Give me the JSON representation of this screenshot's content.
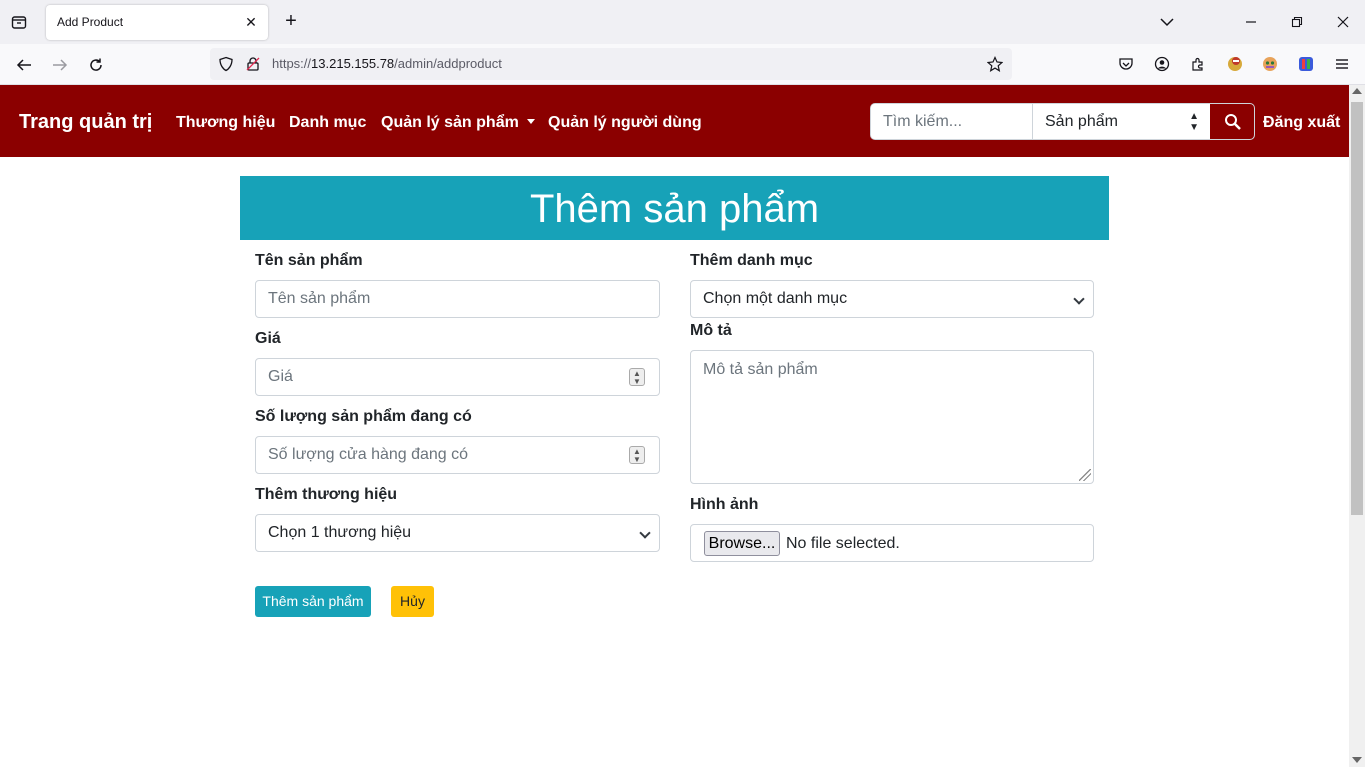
{
  "browser": {
    "tab_title": "Add Product",
    "url_prefix": "https://",
    "url_host": "13.215.155.78",
    "url_path": "/admin/addproduct"
  },
  "nav": {
    "brand": "Trang quản trị",
    "links": [
      "Thương hiệu",
      "Danh mục",
      "Quản lý sản phẩm",
      "Quản lý người dùng"
    ],
    "search_placeholder": "Tìm kiếm...",
    "search_category": "Sản phẩm",
    "logout": "Đăng xuất"
  },
  "form": {
    "heading": "Thêm sản phẩm",
    "name_label": "Tên sản phẩm",
    "name_placeholder": "Tên sản phẩm",
    "price_label": "Giá",
    "price_placeholder": "Giá",
    "stock_label": "Số lượng sản phẩm đang có",
    "stock_placeholder": "Số lượng cửa hàng đang có",
    "brand_label": "Thêm thương hiệu",
    "brand_selected": "Chọn 1 thương hiệu",
    "category_label": "Thêm danh mục",
    "category_selected": "Chọn một danh mục",
    "description_label": "Mô tả",
    "description_placeholder": "Mô tả sản phẩm",
    "image_label": "Hình ảnh",
    "browse_label": "Browse...",
    "no_file": "No file selected.",
    "submit_label": "Thêm sản phẩm",
    "cancel_label": "Hủy"
  },
  "colors": {
    "nav_bg": "#8b0000",
    "heading_bg": "#17a2b8",
    "cancel_bg": "#ffc107"
  }
}
